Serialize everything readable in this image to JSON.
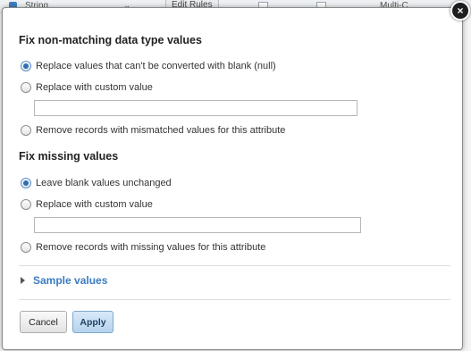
{
  "background": {
    "type_label": "String",
    "edit_rules_label": "Edit Rules",
    "multi_label": "Multi-C"
  },
  "dialog": {
    "close_glyph": "×",
    "datatype_section": {
      "title": "Fix non-matching data type values",
      "options": [
        "Replace values that can't be converted with blank (null)",
        "Replace with custom value",
        "Remove records with mismatched values for this attribute"
      ],
      "selected_index": 0,
      "custom_value": ""
    },
    "missing_section": {
      "title": "Fix missing values",
      "options": [
        "Leave blank values unchanged",
        "Replace with custom value",
        "Remove records with missing values for this attribute"
      ],
      "selected_index": 0,
      "custom_value": ""
    },
    "sample_values_label": "Sample values",
    "cancel_label": "Cancel",
    "apply_label": "Apply"
  },
  "colors": {
    "accent": "#3a7cc1",
    "apply_button": "#b5d2ec",
    "close_button": "#1e1e1e"
  },
  "icons": {
    "close": "close-icon",
    "expand": "caret-right-icon"
  }
}
